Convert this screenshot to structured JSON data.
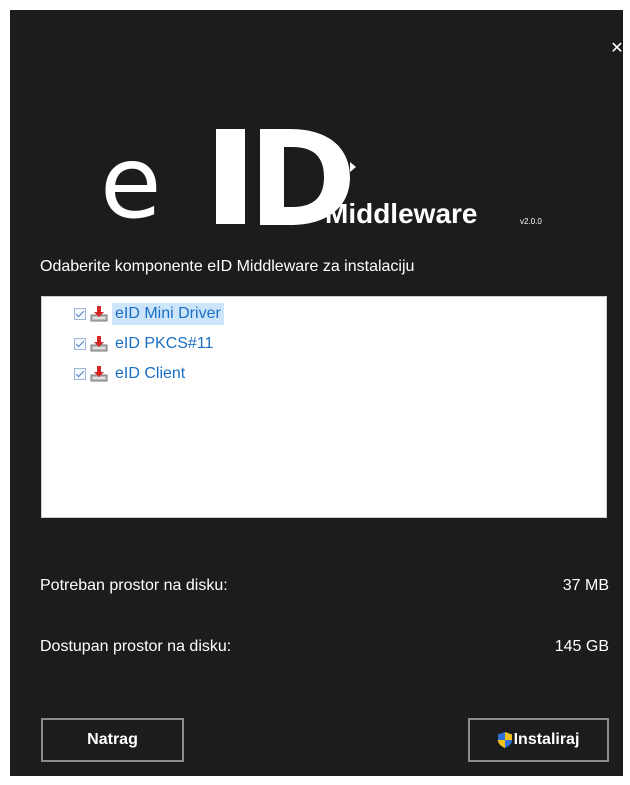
{
  "window": {
    "close_icon": "close-icon"
  },
  "logo": {
    "letter_e": "e",
    "product": "Middleware",
    "version": "v2.0.0"
  },
  "prompt": "Odaberite komponente eID Middleware za instalaciju",
  "components": [
    {
      "label": "eID Mini Driver",
      "checked": true,
      "selected": true,
      "icon": "package-install-icon"
    },
    {
      "label": "eID PKCS#11",
      "checked": true,
      "selected": false,
      "icon": "package-install-icon"
    },
    {
      "label": "eID Client",
      "checked": true,
      "selected": false,
      "icon": "package-install-icon"
    }
  ],
  "disk": {
    "required_label": "Potreban prostor na disku:",
    "required_value": "37 MB",
    "available_label": "Dostupan prostor na disku:",
    "available_value": "145 GB"
  },
  "buttons": {
    "back_label": "Natrag",
    "install_label": "Instaliraj",
    "install_icon": "uac-shield-icon"
  },
  "colors": {
    "background": "#1c1c1c",
    "link_text": "#1a6fc4",
    "selection": "#cce5fb",
    "button_border": "#8c8c8c"
  }
}
